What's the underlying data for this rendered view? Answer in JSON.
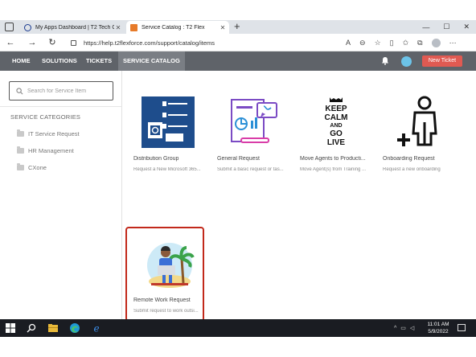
{
  "browser": {
    "tabs": [
      {
        "title": "My Apps Dashboard | T2 Tech G"
      },
      {
        "title": "Service Catalog : T2 Flex"
      }
    ],
    "new_tab_symbol": "+",
    "url": "https://help.t2flexforce.com/support/catalog/items",
    "window_controls": [
      "—",
      "☐",
      "✕"
    ]
  },
  "appnav": {
    "items": [
      "HOME",
      "SOLUTIONS",
      "TICKETS",
      "SERVICE CATALOG"
    ],
    "selected": "SERVICE CATALOG",
    "new_ticket_label": "New Ticket"
  },
  "sidebar": {
    "search_placeholder": "Search for Service Item",
    "categories_heading": "SERVICE CATEGORIES",
    "categories": [
      "IT Service Request",
      "HR Management",
      "CXone"
    ]
  },
  "catalog": {
    "items": [
      {
        "title": "Distribution Group",
        "desc": "Request a New Microsoft 365..."
      },
      {
        "title": "General Request",
        "desc": "Submit a basic request or tas..."
      },
      {
        "title": "Move Agents to Producti...",
        "desc": "Move Agent(s) from Training ..."
      },
      {
        "title": "Onboarding Request",
        "desc": "Request a new onboarding"
      },
      {
        "title": "Remote Work Request",
        "desc": "Submit request to work outsi..."
      }
    ],
    "keep_calm_text": [
      "KEEP",
      "CALM",
      "AND",
      "GO",
      "LIVE"
    ]
  },
  "taskbar": {
    "time": "11:01 AM",
    "date": "5/9/2022"
  },
  "colors": {
    "nav_bg": "#5f6369",
    "new_ticket": "#e05a52",
    "highlight": "#c2291b"
  }
}
